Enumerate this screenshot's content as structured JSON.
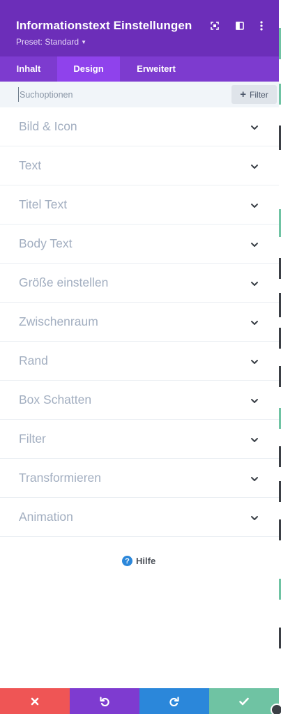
{
  "header": {
    "title": "Informationstext Einstellungen",
    "preset": "Preset: Standard",
    "icons": [
      "fullscreen-icon",
      "sidebar-layout-icon",
      "more-vertical-icon"
    ]
  },
  "tabs": [
    {
      "label": "Inhalt",
      "active": false
    },
    {
      "label": "Design",
      "active": true
    },
    {
      "label": "Erweitert",
      "active": false
    }
  ],
  "search": {
    "placeholder": "Suchoptionen",
    "value": "",
    "filter_label": "Filter"
  },
  "options": [
    {
      "label": "Bild & Icon"
    },
    {
      "label": "Text"
    },
    {
      "label": "Titel Text"
    },
    {
      "label": "Body Text"
    },
    {
      "label": "Größe einstellen"
    },
    {
      "label": "Zwischenraum"
    },
    {
      "label": "Rand"
    },
    {
      "label": "Box Schatten"
    },
    {
      "label": "Filter"
    },
    {
      "label": "Transformieren"
    },
    {
      "label": "Animation"
    }
  ],
  "help": {
    "label": "Hilfe"
  },
  "footer": [
    {
      "name": "cancel-button",
      "icon": "close-icon",
      "color": "#ef5555"
    },
    {
      "name": "undo-button",
      "icon": "undo-icon",
      "color": "#7e3bd0"
    },
    {
      "name": "redo-button",
      "icon": "redo-icon",
      "color": "#2b87da"
    },
    {
      "name": "save-button",
      "icon": "check-icon",
      "color": "#6fc3a3"
    }
  ],
  "colors": {
    "header": "#6c2eb9",
    "tabs": "#7d3bcf",
    "tab_active": "#8f42ec",
    "option_text": "#a2aec0",
    "search_bg": "#f1f5f9"
  }
}
